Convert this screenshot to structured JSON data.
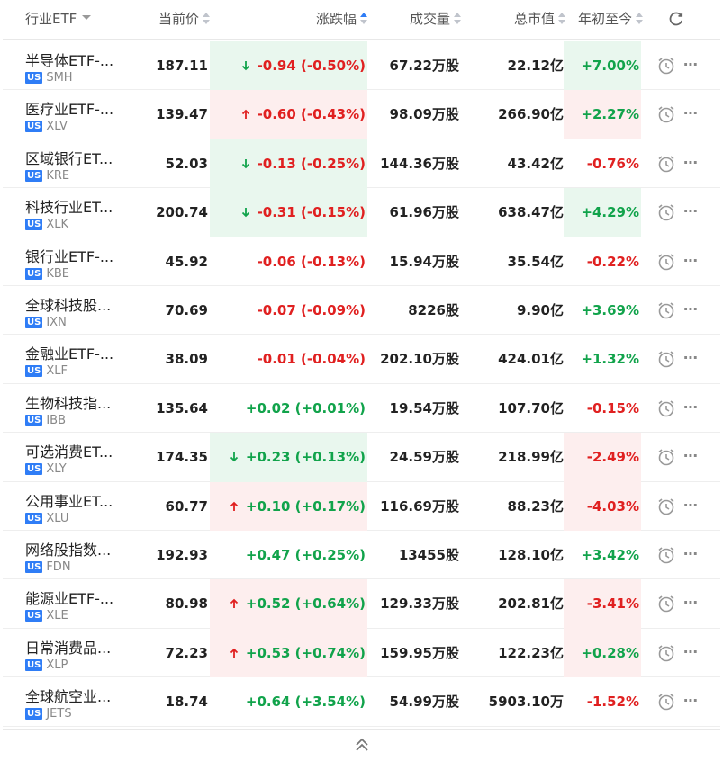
{
  "header": {
    "industry_etf": "行业ETF",
    "price": "当前价",
    "change": "涨跌幅",
    "volume": "成交量",
    "market_cap": "总市值",
    "ytd": "年初至今"
  },
  "badge": "US",
  "rows": [
    {
      "name": "半导体ETF-...",
      "ticker": "SMH",
      "price": "187.11",
      "change": "-0.94 (-0.50%)",
      "volume": "67.22万股",
      "cap": "22.12亿",
      "ytd": "+7.00%",
      "change_color": "red",
      "ytd_color": "green",
      "highlight": "down",
      "arrow": "down",
      "ytd_bg": "down"
    },
    {
      "name": "医疗业ETF-...",
      "ticker": "XLV",
      "price": "139.47",
      "change": "-0.60 (-0.43%)",
      "volume": "98.09万股",
      "cap": "266.90亿",
      "ytd": "+2.27%",
      "change_color": "red",
      "ytd_color": "green",
      "highlight": "up",
      "arrow": "up",
      "ytd_bg": "up"
    },
    {
      "name": "区域银行ET...",
      "ticker": "KRE",
      "price": "52.03",
      "change": "-0.13 (-0.25%)",
      "volume": "144.36万股",
      "cap": "43.42亿",
      "ytd": "-0.76%",
      "change_color": "red",
      "ytd_color": "red",
      "highlight": "down",
      "arrow": "down",
      "ytd_bg": "none"
    },
    {
      "name": "科技行业ET...",
      "ticker": "XLK",
      "price": "200.74",
      "change": "-0.31 (-0.15%)",
      "volume": "61.96万股",
      "cap": "638.47亿",
      "ytd": "+4.29%",
      "change_color": "red",
      "ytd_color": "green",
      "highlight": "down",
      "arrow": "down",
      "ytd_bg": "down"
    },
    {
      "name": "银行业ETF-...",
      "ticker": "KBE",
      "price": "45.92",
      "change": "-0.06 (-0.13%)",
      "volume": "15.94万股",
      "cap": "35.54亿",
      "ytd": "-0.22%",
      "change_color": "red",
      "ytd_color": "red",
      "highlight": "none",
      "arrow": "none",
      "ytd_bg": "none"
    },
    {
      "name": "全球科技股...",
      "ticker": "IXN",
      "price": "70.69",
      "change": "-0.07 (-0.09%)",
      "volume": "8226股",
      "cap": "9.90亿",
      "ytd": "+3.69%",
      "change_color": "red",
      "ytd_color": "green",
      "highlight": "none",
      "arrow": "none",
      "ytd_bg": "none"
    },
    {
      "name": "金融业ETF-...",
      "ticker": "XLF",
      "price": "38.09",
      "change": "-0.01 (-0.04%)",
      "volume": "202.10万股",
      "cap": "424.01亿",
      "ytd": "+1.32%",
      "change_color": "red",
      "ytd_color": "green",
      "highlight": "none",
      "arrow": "none",
      "ytd_bg": "none"
    },
    {
      "name": "生物科技指...",
      "ticker": "IBB",
      "price": "135.64",
      "change": "+0.02 (+0.01%)",
      "volume": "19.54万股",
      "cap": "107.70亿",
      "ytd": "-0.15%",
      "change_color": "green",
      "ytd_color": "red",
      "highlight": "none",
      "arrow": "none",
      "ytd_bg": "none"
    },
    {
      "name": "可选消费ET...",
      "ticker": "XLY",
      "price": "174.35",
      "change": "+0.23 (+0.13%)",
      "volume": "24.59万股",
      "cap": "218.99亿",
      "ytd": "-2.49%",
      "change_color": "green",
      "ytd_color": "red",
      "highlight": "down",
      "arrow": "down",
      "ytd_bg": "up"
    },
    {
      "name": "公用事业ET...",
      "ticker": "XLU",
      "price": "60.77",
      "change": "+0.10 (+0.17%)",
      "volume": "116.69万股",
      "cap": "88.23亿",
      "ytd": "-4.03%",
      "change_color": "green",
      "ytd_color": "red",
      "highlight": "up",
      "arrow": "up",
      "ytd_bg": "up"
    },
    {
      "name": "网络股指数...",
      "ticker": "FDN",
      "price": "192.93",
      "change": "+0.47 (+0.25%)",
      "volume": "13455股",
      "cap": "128.10亿",
      "ytd": "+3.42%",
      "change_color": "green",
      "ytd_color": "green",
      "highlight": "none",
      "arrow": "none",
      "ytd_bg": "none"
    },
    {
      "name": "能源业ETF-...",
      "ticker": "XLE",
      "price": "80.98",
      "change": "+0.52 (+0.64%)",
      "volume": "129.33万股",
      "cap": "202.81亿",
      "ytd": "-3.41%",
      "change_color": "green",
      "ytd_color": "red",
      "highlight": "up",
      "arrow": "up",
      "ytd_bg": "up"
    },
    {
      "name": "日常消费品...",
      "ticker": "XLP",
      "price": "72.23",
      "change": "+0.53 (+0.74%)",
      "volume": "159.95万股",
      "cap": "122.23亿",
      "ytd": "+0.28%",
      "change_color": "green",
      "ytd_color": "green",
      "highlight": "up",
      "arrow": "up",
      "ytd_bg": "up"
    },
    {
      "name": "全球航空业...",
      "ticker": "JETS",
      "price": "18.74",
      "change": "+0.64 (+3.54%)",
      "volume": "54.99万股",
      "cap": "5903.10万",
      "ytd": "-1.52%",
      "change_color": "green",
      "ytd_color": "red",
      "highlight": "none",
      "arrow": "none",
      "ytd_bg": "none"
    }
  ],
  "colors": {
    "up_text": "#e02020",
    "down_text": "#11a34b",
    "up_bg": "#fdeeee",
    "down_bg": "#e9f7ee",
    "badge": "#2f7df6"
  },
  "icons": {
    "refresh": "refresh-icon",
    "alarm": "alarm-clock-icon",
    "more": "more-icon",
    "collapse": "chevron-up-double-icon"
  }
}
